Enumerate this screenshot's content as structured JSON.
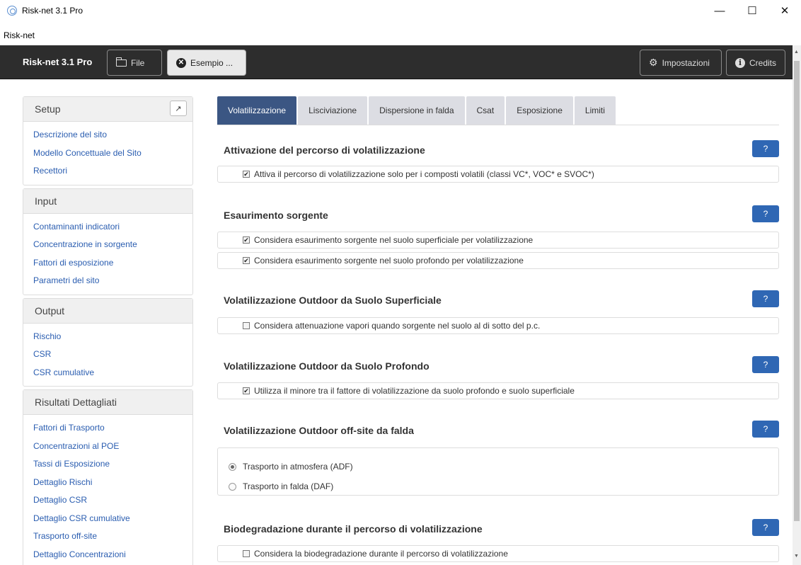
{
  "window": {
    "title": "Risk-net 3.1 Pro",
    "controls": {
      "minimize": "—",
      "maximize": "☐",
      "close": "✕"
    }
  },
  "menu": {
    "label": "Risk-net"
  },
  "navbar": {
    "brand": "Risk-net 3.1 Pro",
    "file_label": "File",
    "example_label": "Esempio ...",
    "settings_label": "Impostazioni",
    "credits_label": "Credits"
  },
  "sidebar": {
    "compress_icon": "↗",
    "panels": [
      {
        "title": "Setup",
        "items": [
          "Descrizione del sito",
          "Modello Concettuale del Sito",
          "Recettori"
        ]
      },
      {
        "title": "Input",
        "items": [
          "Contaminanti indicatori",
          "Concentrazione in sorgente",
          "Fattori di esposizione",
          "Parametri del sito"
        ]
      },
      {
        "title": "Output",
        "items": [
          "Rischio",
          "CSR",
          "CSR cumulative"
        ]
      },
      {
        "title": "Risultati Dettagliati",
        "items": [
          "Fattori di Trasporto",
          "Concentrazioni al POE",
          "Tassi di Esposizione",
          "Dettaglio Rischi",
          "Dettaglio CSR",
          "Dettaglio CSR cumulative",
          "Trasporto off-site",
          "Dettaglio Concentrazioni"
        ]
      }
    ]
  },
  "tabs": [
    "Volatilizzazione",
    "Lisciviazione",
    "Dispersione in falda",
    "Csat",
    "Esposizione",
    "Limiti"
  ],
  "active_tab": "Volatilizzazione",
  "help_label": "?",
  "sections": {
    "s1": {
      "title": "Attivazione del percorso di volatilizzazione",
      "options": [
        {
          "label": "Attiva il percorso di volatilizzazione solo per i composti volatili (classi VC*, VOC* e SVOC*)",
          "checked": true
        }
      ]
    },
    "s2": {
      "title": "Esaurimento sorgente",
      "options": [
        {
          "label": "Considera esaurimento sorgente nel suolo superficiale per volatilizzazione",
          "checked": true
        },
        {
          "label": "Considera esaurimento sorgente nel suolo profondo per volatilizzazione",
          "checked": true
        }
      ]
    },
    "s3": {
      "title": "Volatilizzazione Outdoor da Suolo Superficiale",
      "options": [
        {
          "label": "Considera attenuazione vapori quando sorgente nel suolo al di sotto del p.c.",
          "checked": false
        }
      ]
    },
    "s4": {
      "title": "Volatilizzazione Outdoor da Suolo Profondo",
      "options": [
        {
          "label": "Utilizza il minore tra il fattore di volatilizzazione da suolo profondo e suolo superficiale",
          "checked": true
        }
      ]
    },
    "s5": {
      "title": "Volatilizzazione Outdoor off-site da falda",
      "radios": [
        {
          "label": "Trasporto in atmosfera (ADF)",
          "selected": true
        },
        {
          "label": "Trasporto in falda (DAF)",
          "selected": false
        }
      ]
    },
    "s6": {
      "title": "Biodegradazione durante il percorso di volatilizzazione",
      "options": [
        {
          "label": "Considera la biodegradazione durante il percorso di volatilizzazione",
          "checked": false
        }
      ]
    }
  },
  "check_mark": "✔"
}
